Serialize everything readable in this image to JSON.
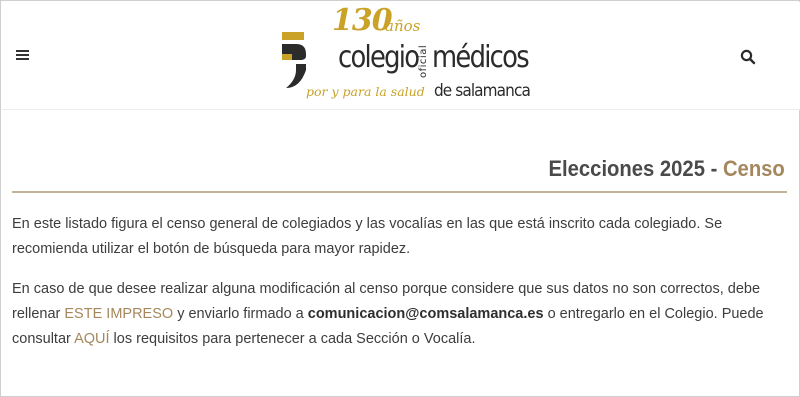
{
  "header": {
    "logo": {
      "anniversary_number": "130",
      "anniversary_word": "años",
      "name_part1": "colegio",
      "name_vertical": "oficial",
      "name_part2": "médicos",
      "tagline": "por y para la salud",
      "city": "de salamanca"
    },
    "menu_icon": "hamburger-icon",
    "search_icon": "search-icon"
  },
  "page": {
    "title_main": "Elecciones 2025 - ",
    "title_accent": "Censo"
  },
  "content": {
    "p1": "En este listado figura el censo general de colegiados y las vocalías en las que está inscrito cada colegiado. Se recomienda utilizar el botón de búsqueda para mayor rapidez.",
    "p2_a": "En caso de que desee realizar alguna modificación al censo porque considere que sus datos no son correctos, debe rellenar ",
    "p2_link1": "ESTE IMPRESO",
    "p2_b": " y enviarlo firmado a ",
    "p2_email": "comunicacion@comsalamanca.es",
    "p2_c": " o entregarlo en el Colegio. Puede consultar ",
    "p2_link2": "AQUÍ",
    "p2_d": " los requisitos para pertenecer a cada Sección o Vocalía."
  },
  "colors": {
    "accent": "#a4875d",
    "logo_gold": "#c9a227",
    "text": "#3d3d3d",
    "rule": "#c3b39a"
  }
}
